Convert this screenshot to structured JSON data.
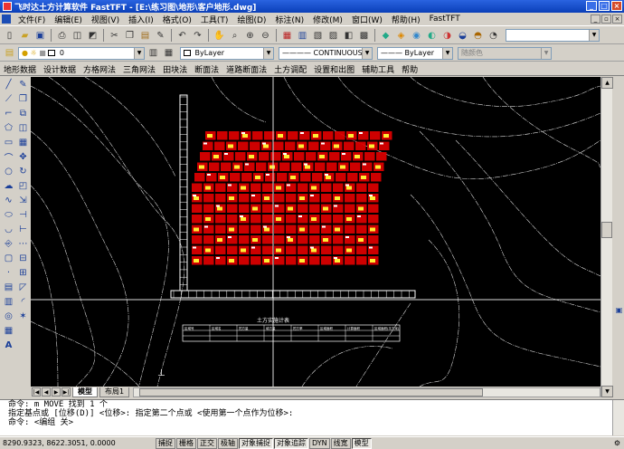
{
  "window": {
    "title": "飞时达土方计算软件 FastTFT - [E:\\练习图\\地形\\客户地形.dwg]",
    "controls": [
      "_",
      "□",
      "×"
    ]
  },
  "menu": {
    "items": [
      "文件(F)",
      "编辑(E)",
      "视图(V)",
      "插入(I)",
      "格式(O)",
      "工具(T)",
      "绘图(D)",
      "标注(N)",
      "修改(M)",
      "窗口(W)",
      "帮助(H)",
      "FastTFT"
    ]
  },
  "layer_bar": {
    "layer_value": "0",
    "color_value": "ByLayer",
    "linetype_value": "CONTINUOUS",
    "lineweight_value": "ByLayer",
    "plotstyle_value": "随颜色"
  },
  "fast_menu": {
    "items": [
      "地形数据",
      "设计数据",
      "方格网法",
      "三角网法",
      "田块法",
      "断面法",
      "道路断面法",
      "土方调配",
      "设置和出图",
      "辅助工具",
      "帮助"
    ]
  },
  "drawing": {
    "table_title": "土方实施计表",
    "table_headers": [
      "区域号",
      "区域名",
      "挖方量",
      "填方量",
      "挖方率",
      "区域面积",
      "计算面积",
      "区域面积(平方米)"
    ]
  },
  "tabs": {
    "items": [
      "模型",
      "布局1"
    ]
  },
  "command": {
    "lines": [
      "命令:  m MOVE 找到 1 个",
      "指定基点或 [位移(D)] <位移>:  指定第二个点或 <使用第一个点作为位移>:",
      "命令: <编组 关>"
    ]
  },
  "status": {
    "coords": "8290.9323,  8622.3051,  0.0000",
    "buttons": [
      "捕捉",
      "栅格",
      "正交",
      "极轴",
      "对象捕捉",
      "对象追踪",
      "DYN",
      "线宽",
      "模型"
    ]
  }
}
